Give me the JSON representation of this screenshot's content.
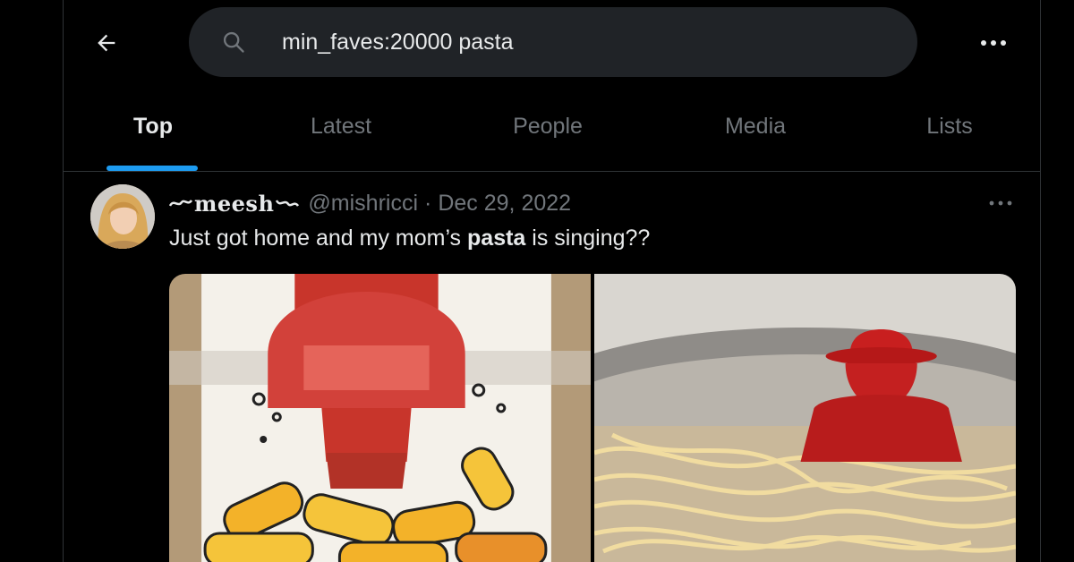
{
  "search": {
    "query": "min_faves:20000 pasta",
    "back_icon": "back-arrow-icon",
    "search_icon": "search-icon",
    "more_icon": "more-icon"
  },
  "tabs": [
    {
      "label": "Top",
      "active": true
    },
    {
      "label": "Latest",
      "active": false
    },
    {
      "label": "People",
      "active": false
    },
    {
      "label": "Media",
      "active": false
    },
    {
      "label": "Lists",
      "active": false
    }
  ],
  "tweet": {
    "display_name": "meesh",
    "handle": "@mishricci",
    "separator": "·",
    "date": "Dec 29, 2022",
    "text_before": "Just got home and my mom’s ",
    "text_bold": "pasta",
    "text_after": " is singing??",
    "media": [
      "pasta-box-illustration",
      "pasta-pot-figurine-photo"
    ]
  },
  "colors": {
    "background": "#000000",
    "accent": "#1d9bf0",
    "search_bg": "#202327",
    "muted_text": "#71767b",
    "primary_text": "#e7e9ea"
  }
}
